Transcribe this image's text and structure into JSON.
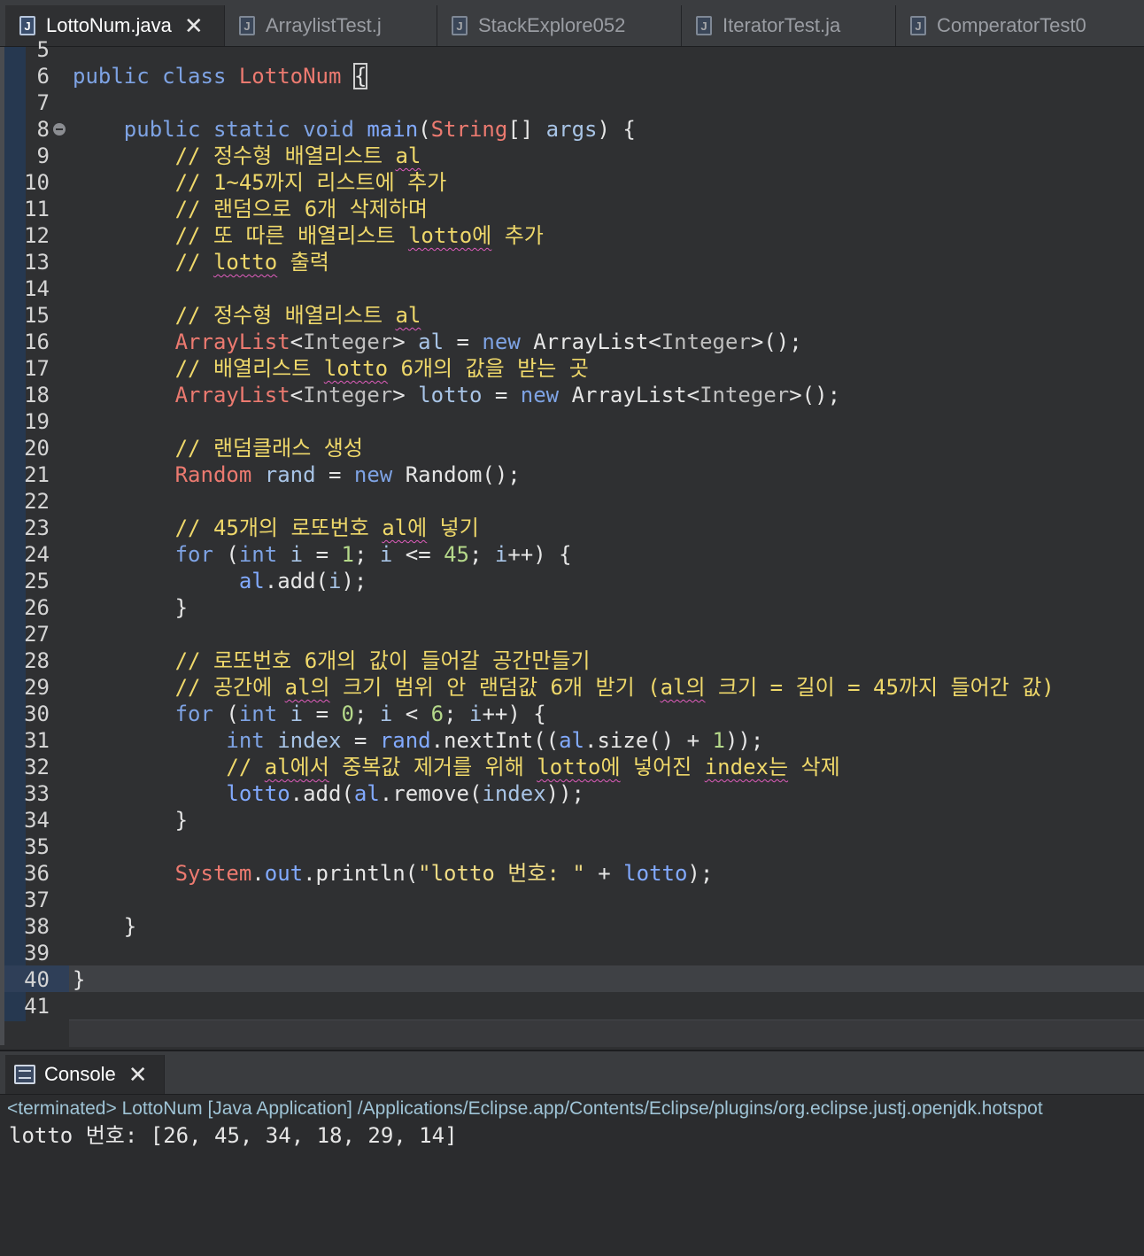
{
  "editor_tabs": [
    {
      "label": "LottoNum.java",
      "active": true,
      "close": "✕"
    },
    {
      "label": "ArraylistTest.j"
    },
    {
      "label": "StackExplore052"
    },
    {
      "label": "IteratorTest.ja"
    },
    {
      "label": "ComperatorTest0"
    }
  ],
  "icons": {
    "java_file_icon": "J",
    "fold_icon": "collapse-circle",
    "console_icon": "monitor-icon"
  },
  "code_lines": [
    {
      "n": "5",
      "tokens": []
    },
    {
      "n": "6",
      "tokens": [
        {
          "c": "kw",
          "t": "public"
        },
        {
          "c": "pl",
          "t": " "
        },
        {
          "c": "kw",
          "t": "class"
        },
        {
          "c": "pl",
          "t": " "
        },
        {
          "c": "cl",
          "t": "LottoNum"
        },
        {
          "c": "pl",
          "t": " "
        },
        {
          "c": "br",
          "t": "{"
        }
      ]
    },
    {
      "n": "7",
      "tokens": []
    },
    {
      "n": "8",
      "fold": true,
      "tokens": [
        {
          "c": "pl",
          "t": "    "
        },
        {
          "c": "kw",
          "t": "public"
        },
        {
          "c": "pl",
          "t": " "
        },
        {
          "c": "kw",
          "t": "static"
        },
        {
          "c": "pl",
          "t": " "
        },
        {
          "c": "kw",
          "t": "void"
        },
        {
          "c": "pl",
          "t": " "
        },
        {
          "c": "fd",
          "t": "main"
        },
        {
          "c": "pl",
          "t": "("
        },
        {
          "c": "cl",
          "t": "String"
        },
        {
          "c": "pl",
          "t": "[] "
        },
        {
          "c": "vr",
          "t": "args"
        },
        {
          "c": "pl",
          "t": ") {"
        }
      ]
    },
    {
      "n": "9",
      "tokens": [
        {
          "c": "pl",
          "t": "        "
        },
        {
          "c": "cm",
          "t": "// 정수형 배열리스트 "
        },
        {
          "c": "cmsq",
          "t": "al"
        }
      ]
    },
    {
      "n": "10",
      "tokens": [
        {
          "c": "pl",
          "t": "        "
        },
        {
          "c": "cm",
          "t": "// 1~45까지 리스트에 추가"
        }
      ]
    },
    {
      "n": "11",
      "tokens": [
        {
          "c": "pl",
          "t": "        "
        },
        {
          "c": "cm",
          "t": "// 랜덤으로 6개 삭제하며"
        }
      ]
    },
    {
      "n": "12",
      "tokens": [
        {
          "c": "pl",
          "t": "        "
        },
        {
          "c": "cm",
          "t": "// 또 따른 배열리스트 "
        },
        {
          "c": "cmsq",
          "t": "lotto에"
        },
        {
          "c": "cm",
          "t": " 추가"
        }
      ]
    },
    {
      "n": "13",
      "tokens": [
        {
          "c": "pl",
          "t": "        "
        },
        {
          "c": "cm",
          "t": "// "
        },
        {
          "c": "cmsq",
          "t": "lotto"
        },
        {
          "c": "cm",
          "t": " 출력"
        }
      ]
    },
    {
      "n": "14",
      "tokens": []
    },
    {
      "n": "15",
      "tokens": [
        {
          "c": "pl",
          "t": "        "
        },
        {
          "c": "cm",
          "t": "// 정수형 배열리스트 "
        },
        {
          "c": "cmsq",
          "t": "al"
        }
      ]
    },
    {
      "n": "16",
      "tokens": [
        {
          "c": "pl",
          "t": "        "
        },
        {
          "c": "cl",
          "t": "ArrayList"
        },
        {
          "c": "pl",
          "t": "<"
        },
        {
          "c": "ty",
          "t": "Integer"
        },
        {
          "c": "pl",
          "t": "> "
        },
        {
          "c": "vr",
          "t": "al"
        },
        {
          "c": "pl",
          "t": " = "
        },
        {
          "c": "kw",
          "t": "new"
        },
        {
          "c": "pl",
          "t": " ArrayList<"
        },
        {
          "c": "ty",
          "t": "Integer"
        },
        {
          "c": "pl",
          "t": ">();"
        }
      ]
    },
    {
      "n": "17",
      "tokens": [
        {
          "c": "pl",
          "t": "        "
        },
        {
          "c": "cm",
          "t": "// 배열리스트 "
        },
        {
          "c": "cmsq",
          "t": "lotto"
        },
        {
          "c": "cm",
          "t": " 6개의 값을 받는 곳"
        }
      ]
    },
    {
      "n": "18",
      "tokens": [
        {
          "c": "pl",
          "t": "        "
        },
        {
          "c": "cl",
          "t": "ArrayList"
        },
        {
          "c": "pl",
          "t": "<"
        },
        {
          "c": "ty",
          "t": "Integer"
        },
        {
          "c": "pl",
          "t": "> "
        },
        {
          "c": "vr",
          "t": "lotto"
        },
        {
          "c": "pl",
          "t": " = "
        },
        {
          "c": "kw",
          "t": "new"
        },
        {
          "c": "pl",
          "t": " ArrayList<"
        },
        {
          "c": "ty",
          "t": "Integer"
        },
        {
          "c": "pl",
          "t": ">();"
        }
      ]
    },
    {
      "n": "19",
      "tokens": []
    },
    {
      "n": "20",
      "tokens": [
        {
          "c": "pl",
          "t": "        "
        },
        {
          "c": "cm",
          "t": "// 랜덤클래스 생성"
        }
      ]
    },
    {
      "n": "21",
      "tokens": [
        {
          "c": "pl",
          "t": "        "
        },
        {
          "c": "cl",
          "t": "Random"
        },
        {
          "c": "pl",
          "t": " "
        },
        {
          "c": "vr",
          "t": "rand"
        },
        {
          "c": "pl",
          "t": " = "
        },
        {
          "c": "kw",
          "t": "new"
        },
        {
          "c": "pl",
          "t": " Random();"
        }
      ]
    },
    {
      "n": "22",
      "tokens": []
    },
    {
      "n": "23",
      "tokens": [
        {
          "c": "pl",
          "t": "        "
        },
        {
          "c": "cm",
          "t": "// 45개의 로또번호 "
        },
        {
          "c": "cmsq",
          "t": "al에"
        },
        {
          "c": "cm",
          "t": " 넣기"
        }
      ]
    },
    {
      "n": "24",
      "tokens": [
        {
          "c": "pl",
          "t": "        "
        },
        {
          "c": "kw",
          "t": "for"
        },
        {
          "c": "pl",
          "t": " ("
        },
        {
          "c": "kw",
          "t": "int"
        },
        {
          "c": "pl",
          "t": " "
        },
        {
          "c": "vr",
          "t": "i"
        },
        {
          "c": "pl",
          "t": " = "
        },
        {
          "c": "num",
          "t": "1"
        },
        {
          "c": "pl",
          "t": "; "
        },
        {
          "c": "vr",
          "t": "i"
        },
        {
          "c": "pl",
          "t": " <= "
        },
        {
          "c": "num",
          "t": "45"
        },
        {
          "c": "pl",
          "t": "; "
        },
        {
          "c": "vr",
          "t": "i"
        },
        {
          "c": "pl",
          "t": "++) {"
        }
      ]
    },
    {
      "n": "25",
      "tokens": [
        {
          "c": "pl",
          "t": "             "
        },
        {
          "c": "fd",
          "t": "al"
        },
        {
          "c": "pl",
          "t": ".add("
        },
        {
          "c": "vr",
          "t": "i"
        },
        {
          "c": "pl",
          "t": ");"
        }
      ]
    },
    {
      "n": "26",
      "tokens": [
        {
          "c": "pl",
          "t": "        }"
        }
      ]
    },
    {
      "n": "27",
      "tokens": []
    },
    {
      "n": "28",
      "tokens": [
        {
          "c": "pl",
          "t": "        "
        },
        {
          "c": "cm",
          "t": "// 로또번호 6개의 값이 들어갈 공간만들기"
        }
      ]
    },
    {
      "n": "29",
      "tokens": [
        {
          "c": "pl",
          "t": "        "
        },
        {
          "c": "cm",
          "t": "// 공간에 "
        },
        {
          "c": "cmsq",
          "t": "al의"
        },
        {
          "c": "cm",
          "t": " 크기 범위 안 랜덤값 6개 받기 ("
        },
        {
          "c": "cmsq",
          "t": "al의"
        },
        {
          "c": "cm",
          "t": " 크기 = 길이 = 45까지 들어간 값)"
        }
      ]
    },
    {
      "n": "30",
      "tokens": [
        {
          "c": "pl",
          "t": "        "
        },
        {
          "c": "kw",
          "t": "for"
        },
        {
          "c": "pl",
          "t": " ("
        },
        {
          "c": "kw",
          "t": "int"
        },
        {
          "c": "pl",
          "t": " "
        },
        {
          "c": "vr",
          "t": "i"
        },
        {
          "c": "pl",
          "t": " = "
        },
        {
          "c": "num",
          "t": "0"
        },
        {
          "c": "pl",
          "t": "; "
        },
        {
          "c": "vr",
          "t": "i"
        },
        {
          "c": "pl",
          "t": " < "
        },
        {
          "c": "num",
          "t": "6"
        },
        {
          "c": "pl",
          "t": "; "
        },
        {
          "c": "vr",
          "t": "i"
        },
        {
          "c": "pl",
          "t": "++) {"
        }
      ]
    },
    {
      "n": "31",
      "tokens": [
        {
          "c": "pl",
          "t": "            "
        },
        {
          "c": "kw",
          "t": "int"
        },
        {
          "c": "pl",
          "t": " "
        },
        {
          "c": "vr",
          "t": "index"
        },
        {
          "c": "pl",
          "t": " = "
        },
        {
          "c": "fd",
          "t": "rand"
        },
        {
          "c": "pl",
          "t": ".nextInt(("
        },
        {
          "c": "fd",
          "t": "al"
        },
        {
          "c": "pl",
          "t": ".size() + "
        },
        {
          "c": "num",
          "t": "1"
        },
        {
          "c": "pl",
          "t": "));"
        }
      ]
    },
    {
      "n": "32",
      "tokens": [
        {
          "c": "pl",
          "t": "            "
        },
        {
          "c": "cm",
          "t": "// "
        },
        {
          "c": "cmsq",
          "t": "al에서"
        },
        {
          "c": "cm",
          "t": " 중복값 제거를 위해 "
        },
        {
          "c": "cmsq",
          "t": "lotto에"
        },
        {
          "c": "cm",
          "t": " 넣어진 "
        },
        {
          "c": "cmsq",
          "t": "index는"
        },
        {
          "c": "cm",
          "t": " 삭제"
        }
      ]
    },
    {
      "n": "33",
      "tokens": [
        {
          "c": "pl",
          "t": "            "
        },
        {
          "c": "fd",
          "t": "lotto"
        },
        {
          "c": "pl",
          "t": ".add("
        },
        {
          "c": "fd",
          "t": "al"
        },
        {
          "c": "pl",
          "t": ".remove("
        },
        {
          "c": "vr",
          "t": "index"
        },
        {
          "c": "pl",
          "t": "));"
        }
      ]
    },
    {
      "n": "34",
      "tokens": [
        {
          "c": "pl",
          "t": "        }"
        }
      ]
    },
    {
      "n": "35",
      "tokens": []
    },
    {
      "n": "36",
      "tokens": [
        {
          "c": "pl",
          "t": "        "
        },
        {
          "c": "cl",
          "t": "System"
        },
        {
          "c": "pl",
          "t": "."
        },
        {
          "c": "fd",
          "t": "out"
        },
        {
          "c": "pl",
          "t": ".println("
        },
        {
          "c": "st",
          "t": "\"lotto 번호: \""
        },
        {
          "c": "pl",
          "t": " + "
        },
        {
          "c": "fd",
          "t": "lotto"
        },
        {
          "c": "pl",
          "t": ");"
        }
      ]
    },
    {
      "n": "37",
      "tokens": []
    },
    {
      "n": "38",
      "tokens": [
        {
          "c": "pl",
          "t": "    }"
        }
      ]
    },
    {
      "n": "39",
      "tokens": []
    },
    {
      "n": "40",
      "tokens": [
        {
          "c": "pl",
          "t": "}"
        }
      ]
    },
    {
      "n": "41",
      "tokens": []
    }
  ],
  "console": {
    "tab_label": "Console",
    "close": "✕",
    "status": "<terminated> LottoNum [Java Application] /Applications/Eclipse.app/Contents/Eclipse/plugins/org.eclipse.justj.openjdk.hotspot",
    "output": "lotto 번호: [26, 45, 34, 18, 29, 14]"
  }
}
